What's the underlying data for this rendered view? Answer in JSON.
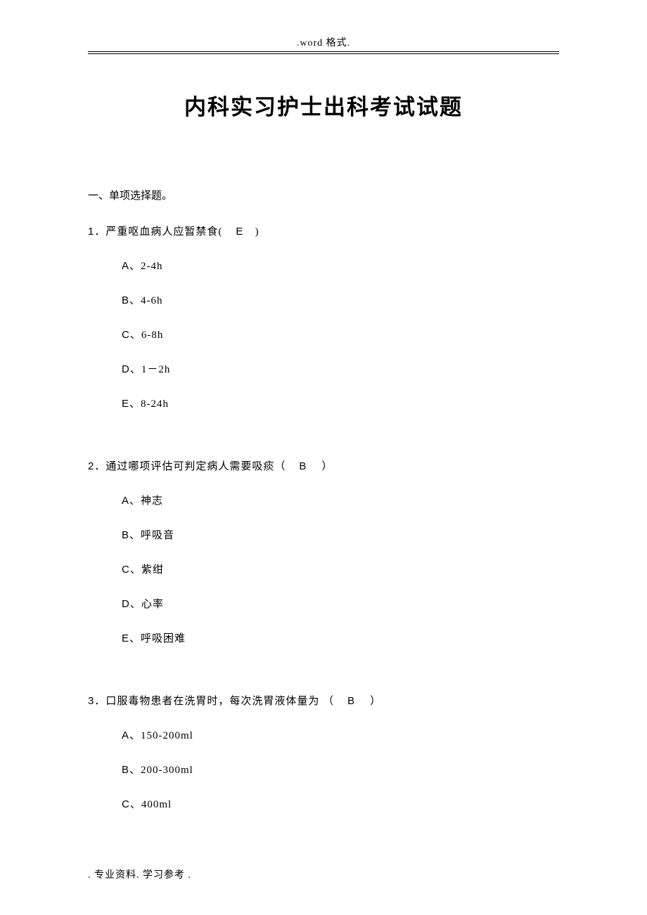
{
  "header": ".word 格式.",
  "title": "内科实习护士出科考试试题",
  "section_heading": "一、单项选择题。",
  "questions": [
    {
      "number": "1",
      "text": "．严重呕血病人应暂禁食(",
      "answer": "E",
      "closing": ")",
      "options": [
        {
          "letter": "A",
          "text": "、2-4h"
        },
        {
          "letter": "B",
          "text": "、4-6h"
        },
        {
          "letter": "C",
          "text": "、6-8h"
        },
        {
          "letter": "D",
          "text": "、1－2h"
        },
        {
          "letter": "E",
          "text": "、8-24h"
        }
      ]
    },
    {
      "number": "2",
      "text": "．通过哪项评估可判定病人需要吸痰（",
      "answer": "B",
      "closing": "）",
      "options": [
        {
          "letter": "A",
          "text": "、神志"
        },
        {
          "letter": "B",
          "text": "、呼吸音"
        },
        {
          "letter": "C",
          "text": "、紫绀"
        },
        {
          "letter": "D",
          "text": "、心率"
        },
        {
          "letter": "E",
          "text": "、呼吸困难"
        }
      ]
    },
    {
      "number": "3",
      "text": "．口服毒物患者在洗胃时，每次洗胃液体量为 （",
      "answer": "B",
      "closing": "）",
      "options": [
        {
          "letter": "A",
          "text": "、150-200ml"
        },
        {
          "letter": "B",
          "text": "、200-300ml"
        },
        {
          "letter": "C",
          "text": "、400ml"
        }
      ]
    }
  ],
  "footer": ".   专业资料. 学习参考      ."
}
